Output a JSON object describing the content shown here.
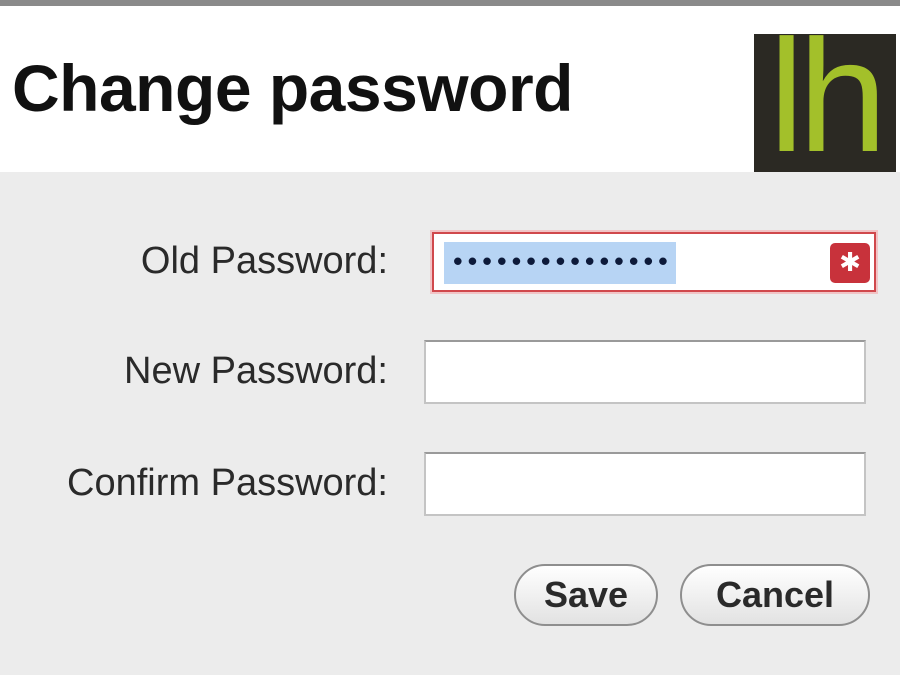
{
  "header": {
    "title": "Change password",
    "logo_text": "lh"
  },
  "form": {
    "old_password": {
      "label": "Old Password:",
      "masked_value": "•••••••••••••••",
      "error": true
    },
    "new_password": {
      "label": "New Password:",
      "value": ""
    },
    "confirm_password": {
      "label": "Confirm Password:",
      "value": ""
    }
  },
  "actions": {
    "save_label": "Save",
    "cancel_label": "Cancel"
  },
  "colors": {
    "logo_bg": "#2b2923",
    "logo_fg": "#a3c02a",
    "error": "#c8323b",
    "selection": "#b7d4f4"
  },
  "icons": {
    "error_icon": "asterisk-icon"
  }
}
